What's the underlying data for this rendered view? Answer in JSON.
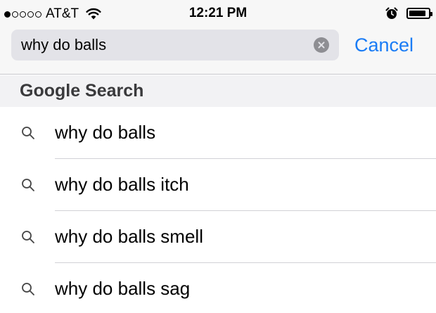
{
  "status_bar": {
    "carrier": "AT&T",
    "time": "12:21 PM",
    "battery_level": 0.9,
    "signal_bars_filled": 1,
    "signal_bars_total": 5
  },
  "search": {
    "query": "why do balls",
    "cancel_label": "Cancel"
  },
  "section": {
    "title": "Google Search"
  },
  "suggestions": [
    {
      "text": "why do balls"
    },
    {
      "text": "why do balls itch"
    },
    {
      "text": "why do balls smell"
    },
    {
      "text": "why do balls sag"
    }
  ],
  "colors": {
    "accent": "#1a7cf5",
    "background": "#f7f7f7",
    "search_field": "#e3e3e8"
  },
  "icons": {
    "suggestion": "search-icon",
    "clear": "clear-icon",
    "alarm": "alarm-icon",
    "wifi": "wifi-icon",
    "battery": "battery-icon"
  }
}
